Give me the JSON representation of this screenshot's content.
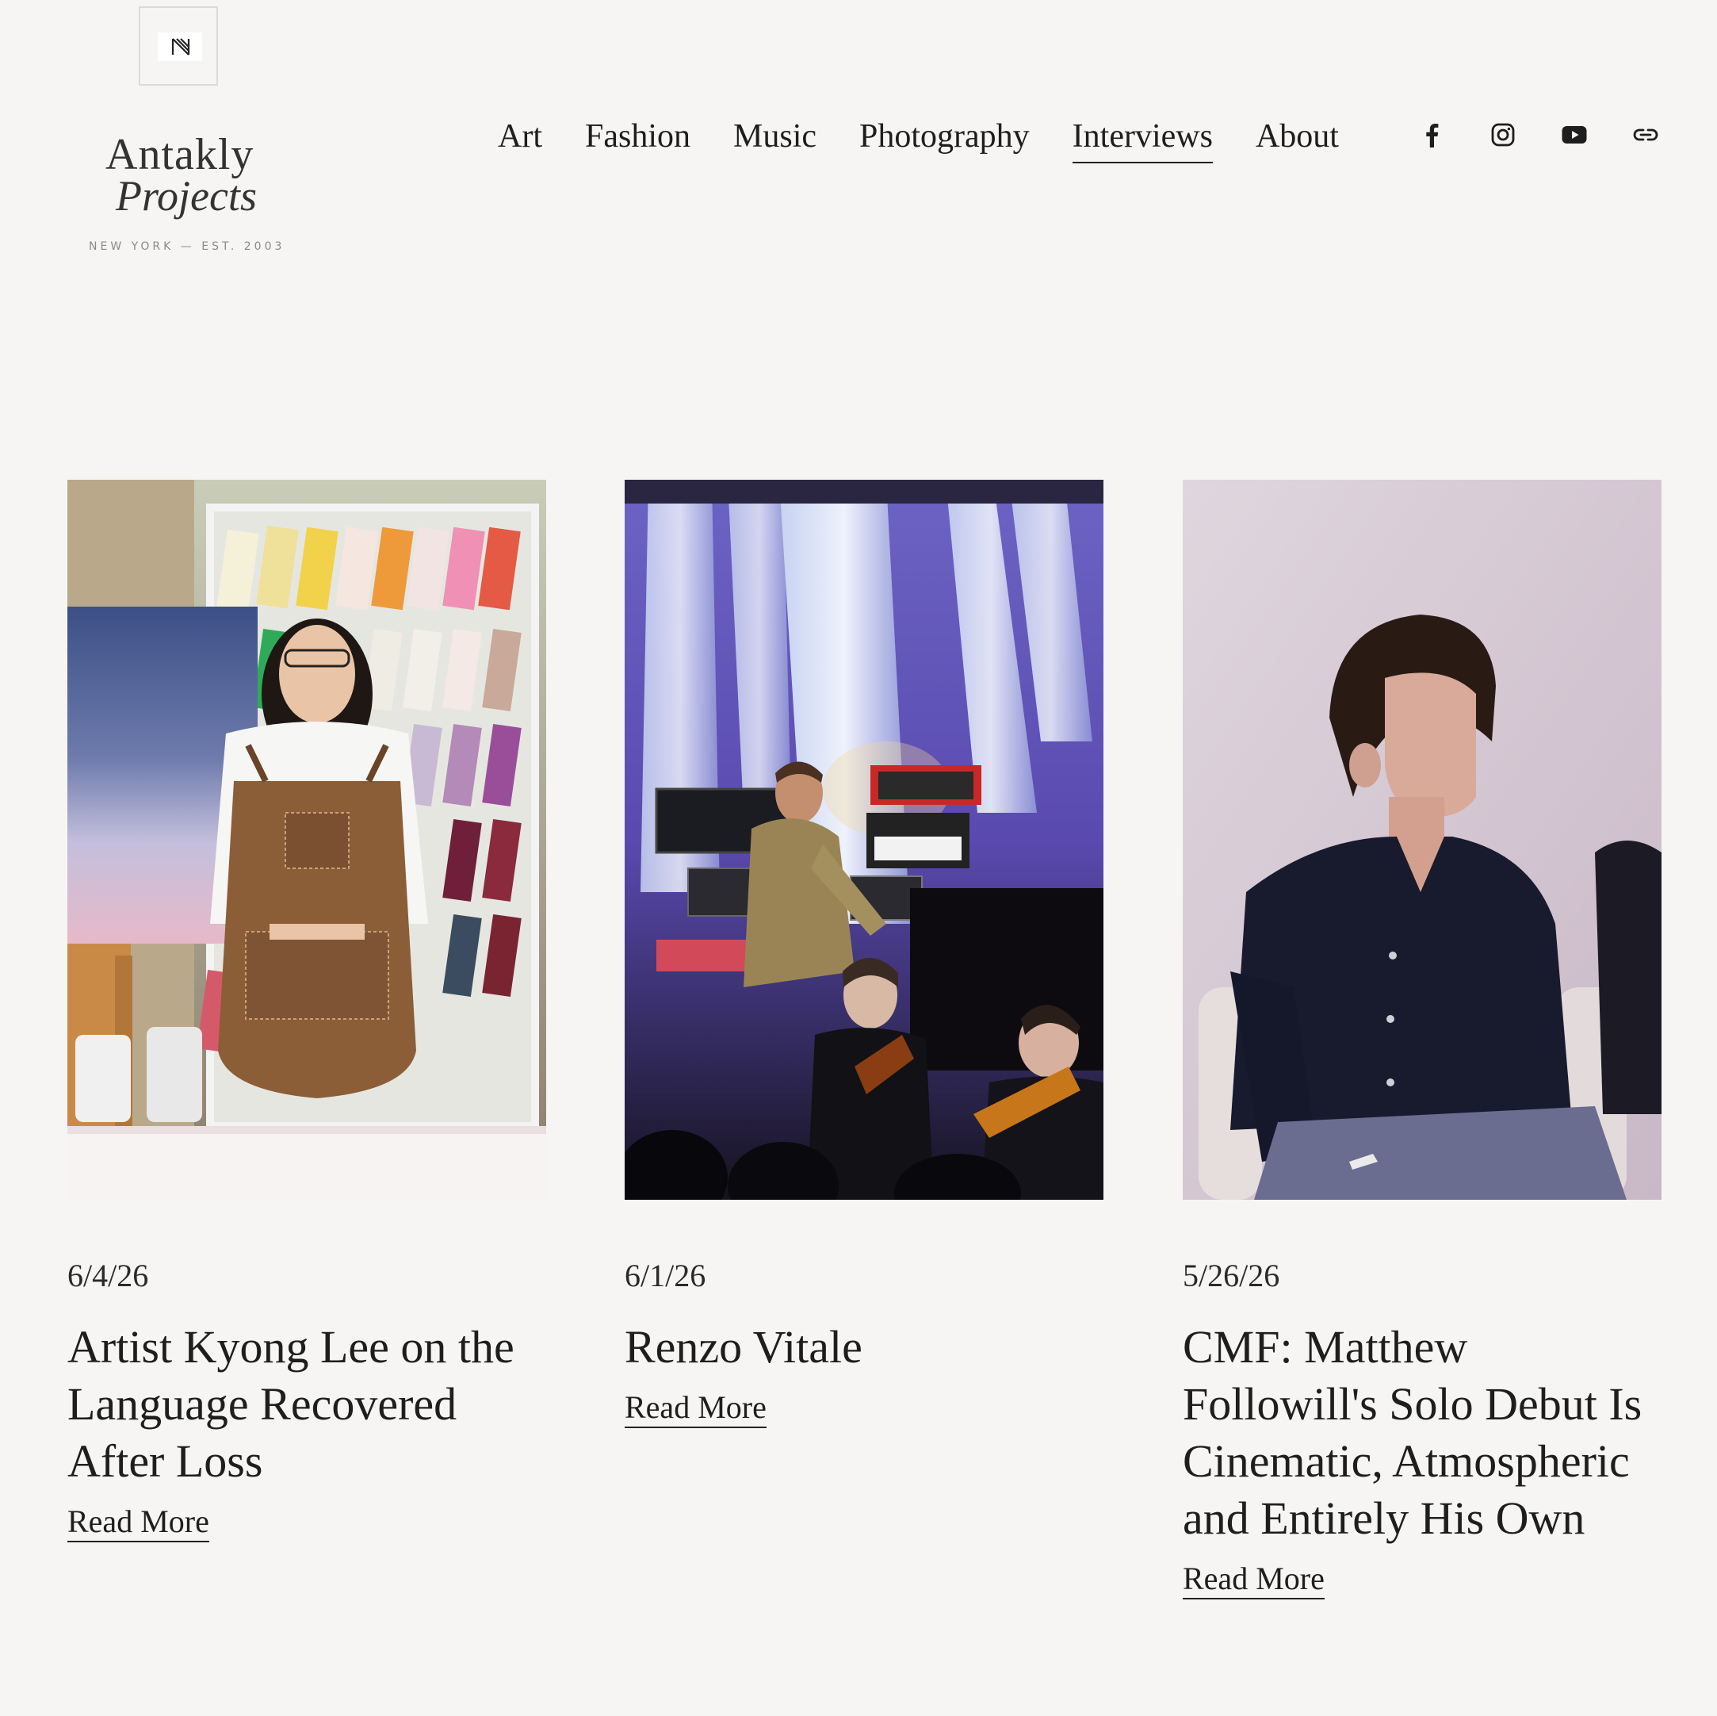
{
  "logo": {
    "line1": "Antakly",
    "line2": "Projects",
    "tagline": "NEW YORK — EST. 2003"
  },
  "nav": {
    "items": [
      {
        "label": "Art"
      },
      {
        "label": "Fashion"
      },
      {
        "label": "Music"
      },
      {
        "label": "Photography"
      },
      {
        "label": "Interviews"
      },
      {
        "label": "About"
      }
    ],
    "active_index": 4
  },
  "social": [
    "facebook-icon",
    "instagram-icon",
    "youtube-icon",
    "link-icon"
  ],
  "posts": [
    {
      "date": "6/4/26",
      "title": "Artist Kyong Lee on the Language Recovered After Loss",
      "read_more": "Read More"
    },
    {
      "date": "6/1/26",
      "title": "Renzo Vitale",
      "read_more": "Read More"
    },
    {
      "date": "5/26/26",
      "title": "CMF: Matthew Followill's Solo Debut Is Cinematic, Atmospheric and Entirely His Own",
      "read_more": "Read More"
    }
  ]
}
